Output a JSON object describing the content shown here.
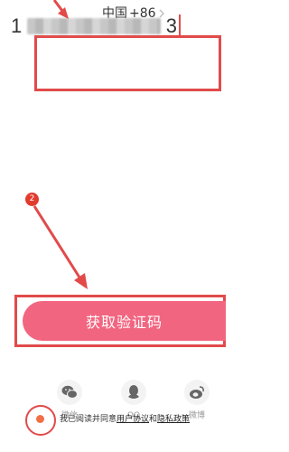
{
  "country": {
    "name": "中国",
    "code": "+86"
  },
  "phone": {
    "first_digit": "1",
    "last_digit": "3"
  },
  "annotation": {
    "step_badge": "2"
  },
  "actions": {
    "get_code_label": "获取验证码"
  },
  "social": [
    {
      "label": "微信",
      "icon": "wechat-icon"
    },
    {
      "label": "QQ",
      "icon": "qq-icon"
    },
    {
      "label": "微博",
      "icon": "weibo-icon"
    }
  ],
  "agreement": {
    "prefix": "我已阅读并同意",
    "user_agreement": "用户协议",
    "and": "和",
    "privacy_policy": "隐私政策"
  },
  "colors": {
    "accent": "#f26580",
    "annotation_red": "#e24a4a",
    "check_orange": "#f07046"
  }
}
